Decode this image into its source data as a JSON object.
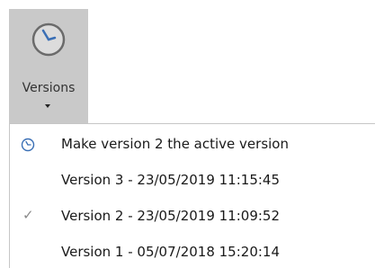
{
  "ribbon": {
    "versions_label": "Versions",
    "clock_icon": "clock-icon",
    "dropdown_icon": "dropdown-arrow-icon",
    "accent_color": "#4a7ab8"
  },
  "menu": {
    "items": [
      {
        "label": "Make version 2 the active version",
        "icon": "clock-icon",
        "checked": false
      },
      {
        "label": "Version 3 - 23/05/2019 11:15:45",
        "icon": "",
        "checked": false
      },
      {
        "label": "Version 2 - 23/05/2019 11:09:52",
        "icon": "checkmark-icon",
        "checked": true,
        "check_glyph": "✓"
      },
      {
        "label": "Version 1 - 05/07/2018 15:20:14",
        "icon": "",
        "checked": false
      }
    ]
  }
}
